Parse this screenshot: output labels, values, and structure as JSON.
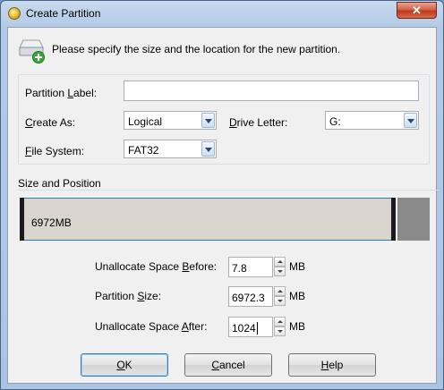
{
  "window": {
    "title": "Create Partition",
    "close_label": "✕"
  },
  "instruction": "Please specify the size and the location for the new partition.",
  "form": {
    "partition_label": {
      "label_pre": "Partition ",
      "label_u": "L",
      "label_post": "abel:",
      "value": ""
    },
    "create_as": {
      "label_pre": "",
      "label_u": "C",
      "label_post": "reate As:",
      "value": "Logical"
    },
    "drive_letter": {
      "label_pre": "",
      "label_u": "D",
      "label_post": "rive Letter:",
      "value": "G:"
    },
    "file_system": {
      "label_pre": "",
      "label_u": "F",
      "label_post": "ile System:",
      "value": "FAT32"
    }
  },
  "size_position": {
    "group_label": "Size and Position",
    "partition_size_text": "6972MB",
    "partition_fraction": 0.917,
    "rows": [
      {
        "label_pre": "Unallocate Space ",
        "label_u": "B",
        "label_post": "efore:",
        "value": "7.8",
        "unit": "MB"
      },
      {
        "label_pre": "Partition ",
        "label_u": "S",
        "label_post": "ize:",
        "value": "6972.3",
        "unit": "MB"
      },
      {
        "label_pre": "Unallocate Space ",
        "label_u": "A",
        "label_post": "fter:",
        "value": "1024",
        "unit": "MB"
      }
    ]
  },
  "buttons": {
    "ok": {
      "label_u": "O",
      "label_post": "K"
    },
    "cancel": {
      "label_u": "C",
      "label_post": "ancel"
    },
    "help": {
      "label_u": "H",
      "label_post": "elp"
    }
  },
  "colors": {
    "accent": "#2a78c8",
    "partition_fill": "#d9d5ce",
    "unallocated_fill": "#8a8a8a"
  },
  "icons": [
    "app-icon",
    "close-icon",
    "add-disk-icon",
    "dropdown-arrow-icon",
    "spin-up-icon",
    "spin-down-icon"
  ]
}
